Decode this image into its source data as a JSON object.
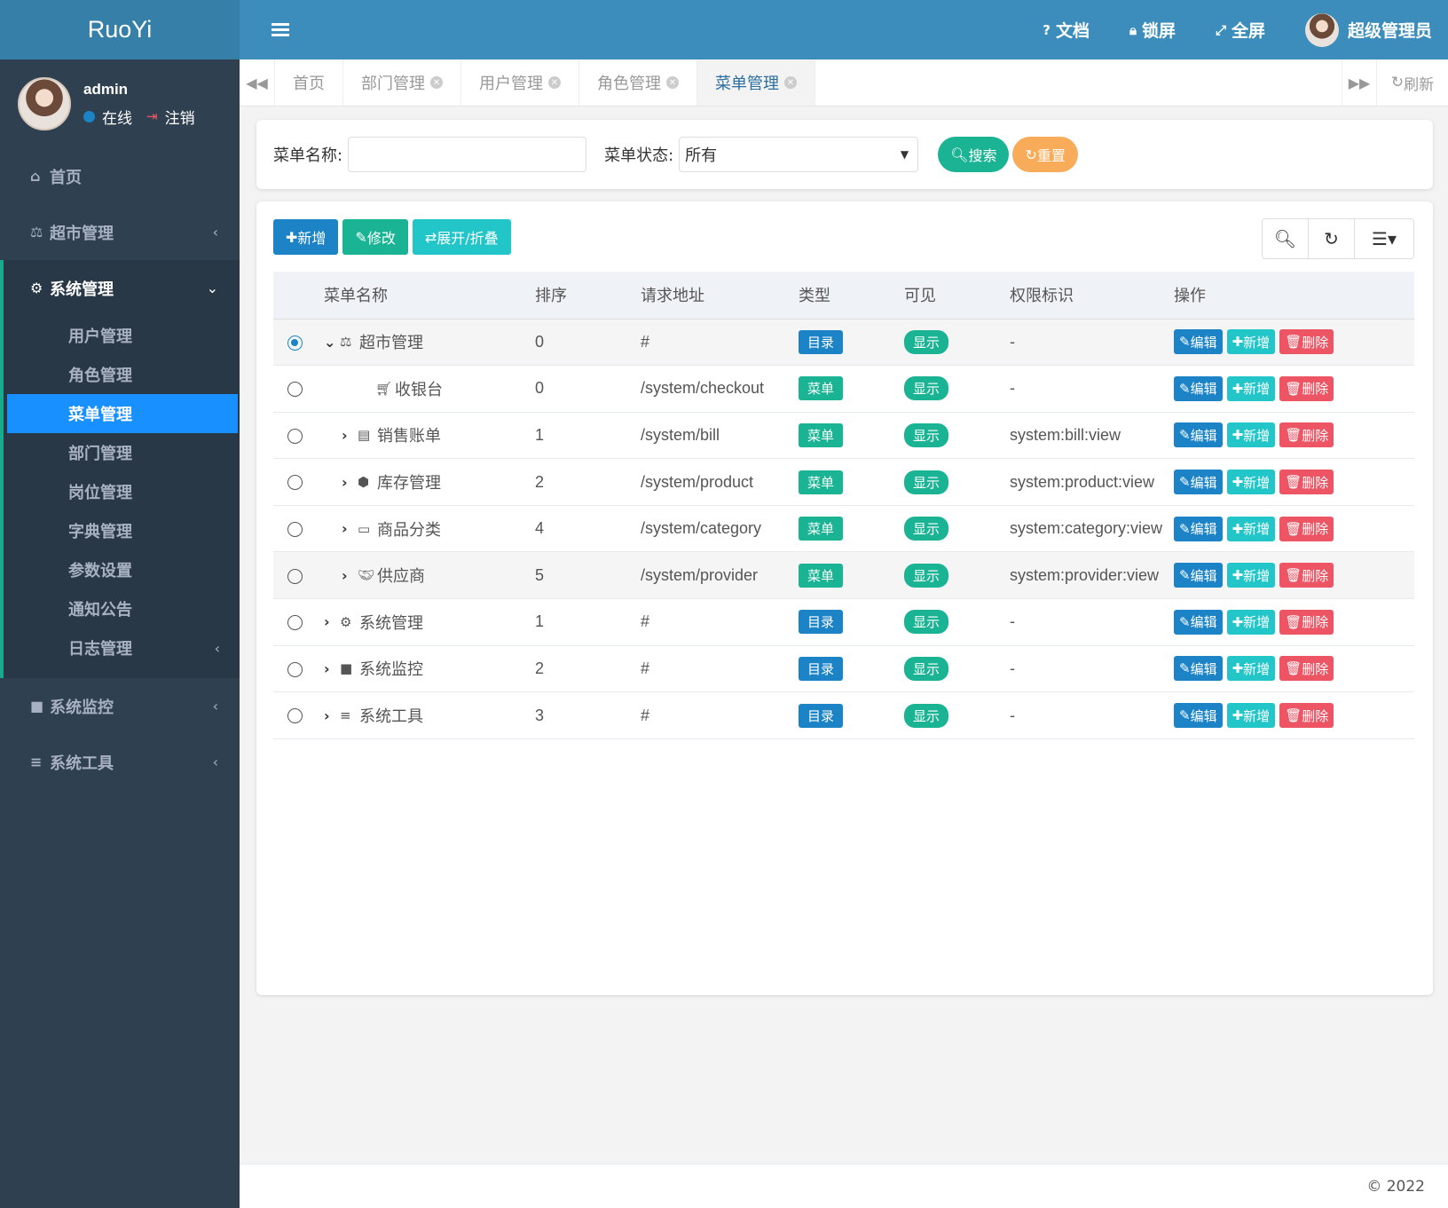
{
  "app": {
    "logo": "RuoYi"
  },
  "user": {
    "name": "admin",
    "status": "在线",
    "logout": "注销",
    "display_name": "超级管理员"
  },
  "topbar": {
    "docs": "文档",
    "lock": "锁屏",
    "fullscreen": "全屏"
  },
  "sidebar": {
    "home": "首页",
    "market": "超市管理",
    "system": "系统管理",
    "system_items": [
      "用户管理",
      "角色管理",
      "菜单管理",
      "部门管理",
      "岗位管理",
      "字典管理",
      "参数设置",
      "通知公告",
      "日志管理"
    ],
    "monitor": "系统监控",
    "tools": "系统工具"
  },
  "tabs": [
    "首页",
    "部门管理",
    "用户管理",
    "角色管理",
    "菜单管理"
  ],
  "refresh": "刷新",
  "search": {
    "name_label": "菜单名称:",
    "name_value": "",
    "status_label": "菜单状态:",
    "status_value": "所有",
    "search_btn": "搜索",
    "reset_btn": "重置"
  },
  "toolbar": {
    "add": "新增",
    "edit": "修改",
    "expand": "展开/折叠"
  },
  "table": {
    "headers": [
      "菜单名称",
      "排序",
      "请求地址",
      "类型",
      "可见",
      "权限标识",
      "操作"
    ],
    "op_labels": {
      "edit": "编辑",
      "add": "新增",
      "delete": "删除"
    },
    "rows": [
      {
        "name": "超市管理",
        "order": "0",
        "url": "#",
        "type": "目录",
        "visible": "显示",
        "perms": "-"
      },
      {
        "name": "收银台",
        "order": "0",
        "url": "/system/checkout",
        "type": "菜单",
        "visible": "显示",
        "perms": "-"
      },
      {
        "name": "销售账单",
        "order": "1",
        "url": "/system/bill",
        "type": "菜单",
        "visible": "显示",
        "perms": "system:bill:view"
      },
      {
        "name": "库存管理",
        "order": "2",
        "url": "/system/product",
        "type": "菜单",
        "visible": "显示",
        "perms": "system:product:view"
      },
      {
        "name": "商品分类",
        "order": "4",
        "url": "/system/category",
        "type": "菜单",
        "visible": "显示",
        "perms": "system:category:view"
      },
      {
        "name": "供应商",
        "order": "5",
        "url": "/system/provider",
        "type": "菜单",
        "visible": "显示",
        "perms": "system:provider:view"
      },
      {
        "name": "系统管理",
        "order": "1",
        "url": "#",
        "type": "目录",
        "visible": "显示",
        "perms": "-"
      },
      {
        "name": "系统监控",
        "order": "2",
        "url": "#",
        "type": "目录",
        "visible": "显示",
        "perms": "-"
      },
      {
        "name": "系统工具",
        "order": "3",
        "url": "#",
        "type": "目录",
        "visible": "显示",
        "perms": "-"
      }
    ]
  },
  "footer": "© 2022",
  "colors": {
    "primary": "#1c84c6",
    "success": "#1ab394",
    "info": "#23c6c8",
    "danger": "#ed5565",
    "warning": "#f8ac59",
    "sidebar": "#2f4050",
    "header": "#3c8dbc"
  }
}
